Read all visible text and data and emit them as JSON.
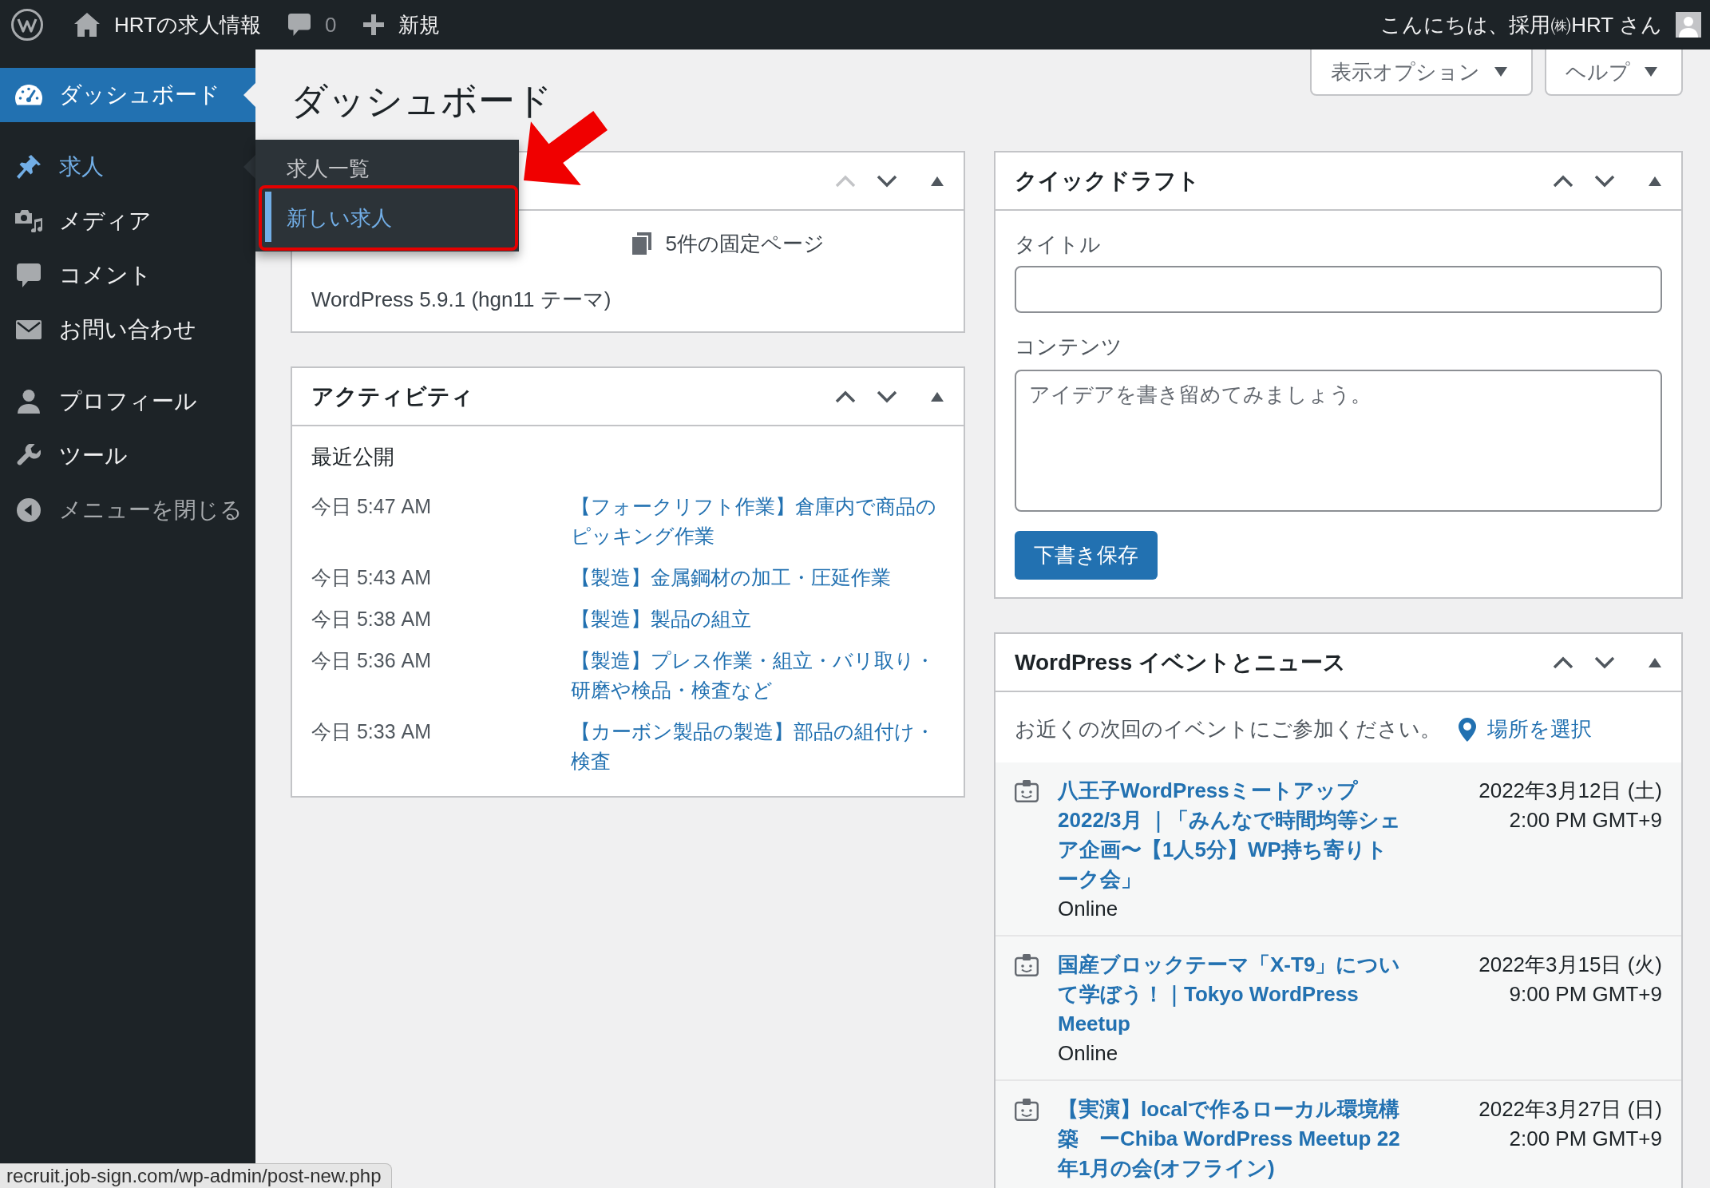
{
  "admin_bar": {
    "site_name": "HRTの求人情報",
    "comment_count": "0",
    "new_label": "新規",
    "greeting": "こんにちは、採用㈱HRT さん"
  },
  "sidebar": {
    "groups": [
      {
        "items": [
          {
            "label": "ダッシュボード",
            "selected": true,
            "expanded": false
          }
        ]
      },
      {
        "items": [
          {
            "label": "求人",
            "selected": false,
            "expanded": true,
            "children": [
              {
                "label": "求人一覧",
                "selected": false,
                "annotated": false
              },
              {
                "label": "新しい求人",
                "selected": true,
                "annotated": true
              }
            ]
          },
          {
            "label": "メディア",
            "selected": false,
            "expanded": false
          },
          {
            "label": "コメント",
            "selected": false,
            "expanded": false
          },
          {
            "label": "お問い合わせ",
            "selected": false,
            "expanded": false
          }
        ]
      },
      {
        "items": [
          {
            "label": "プロフィール",
            "selected": false,
            "expanded": false
          },
          {
            "label": "ツール",
            "selected": false,
            "expanded": false
          }
        ]
      }
    ],
    "collapse_label": "メニューを閉じる"
  },
  "page_title": "ダッシュボード",
  "screen_buttons": [
    "表示オプション",
    "ヘルプ"
  ],
  "columns": [
    {
      "panels": [
        {
          "kind": "glance",
          "up_disabled": true,
          "items": [
            "5件の固定ページ"
          ],
          "footer": "WordPress 5.9.1 (hgn11 テーマ)"
        },
        {
          "kind": "activity",
          "title": "アクティビティ",
          "up_disabled": false,
          "subtitle": "最近公開",
          "rows": [
            {
              "time": "今日 5:47 AM",
              "title": "【フォークリフト作業】倉庫内で商品のピッキング作業"
            },
            {
              "time": "今日 5:43 AM",
              "title": "【製造】金属鋼材の加工・圧延作業"
            },
            {
              "time": "今日 5:38 AM",
              "title": "【製造】製品の組立"
            },
            {
              "time": "今日 5:36 AM",
              "title": "【製造】プレス作業・組立・バリ取り・研磨や検品・検査など"
            },
            {
              "time": "今日 5:33 AM",
              "title": "【カーボン製品の製造】部品の組付け・検査"
            }
          ]
        }
      ]
    },
    {
      "panels": [
        {
          "kind": "quick_draft",
          "title": "クイックドラフト",
          "up_disabled": false,
          "title_label": "タイトル",
          "content_label": "コンテンツ",
          "content_placeholder": "アイデアを書き留めてみましょう。",
          "button": "下書き保存"
        },
        {
          "kind": "events",
          "title": "WordPress イベントとニュース",
          "up_disabled": false,
          "intro": "お近くの次回のイベントにご参加ください。",
          "location_link": "場所を選択",
          "events": [
            {
              "title": "八王子WordPressミートアップ 2022/3月 ｜「みんなで時間均等シェア企画〜【1人5分】WP持ち寄りトーク会」",
              "location": "Online",
              "date": "2022年3月12日 (土)",
              "time": "2:00 PM GMT+9"
            },
            {
              "title": "国産ブロックテーマ「X-T9」について学ぼう！｜Tokyo WordPress Meetup",
              "location": "Online",
              "date": "2022年3月15日 (火)",
              "time": "9:00 PM GMT+9"
            },
            {
              "title": "【実演】localで作るローカル環境構築　ーChiba WordPress Meetup 22年1月の会(オフライン)",
              "date": "2022年3月27日 (日)",
              "time": "2:00 PM GMT+9"
            }
          ]
        }
      ]
    }
  ],
  "status_url": "recruit.job-sign.com/wp-admin/post-new.php"
}
